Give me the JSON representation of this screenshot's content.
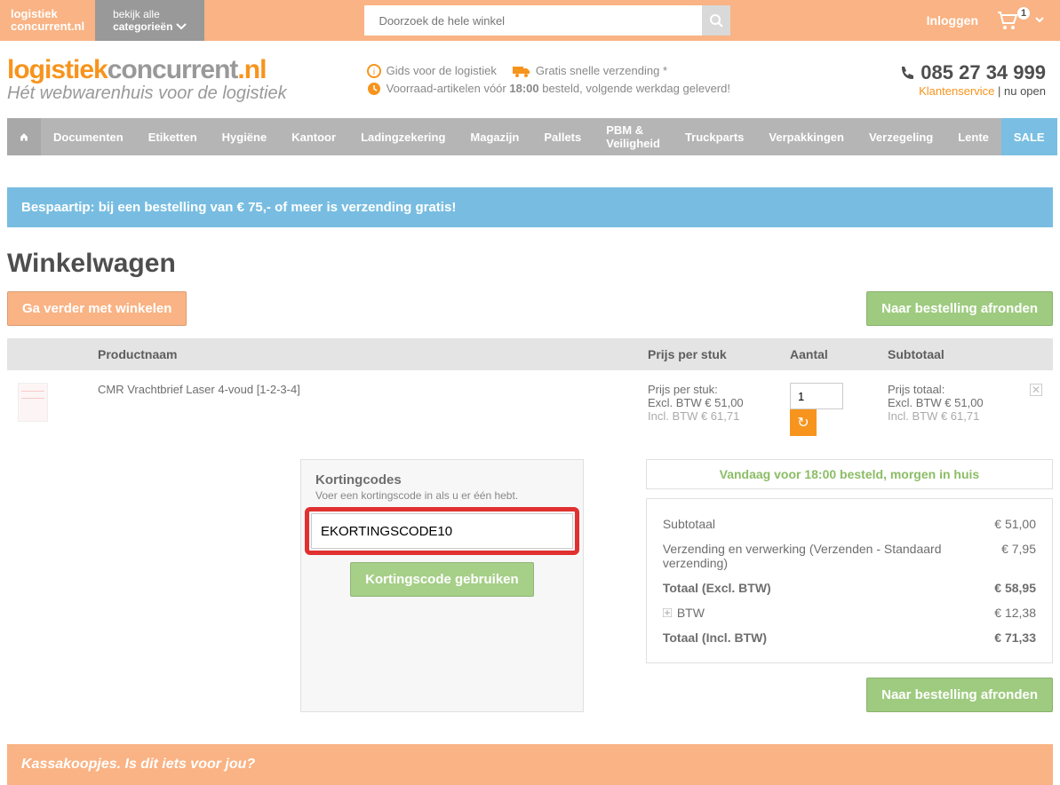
{
  "top": {
    "logo_line1": "logistiek",
    "logo_line2": "concurrent.nl",
    "cat_line1": "bekijk alle",
    "cat_line2": "categorieën",
    "search_placeholder": "Doorzoek de hele winkel",
    "login": "Inloggen",
    "cart_count": "1"
  },
  "header": {
    "logo_part1": "logistiek",
    "logo_part2": "concurrent",
    "logo_part3": ".nl",
    "tagline": "Hét webwarenhuis voor de logistiek",
    "usp_guide": "Gids voor de logistiek",
    "usp_shipping": "Gratis snelle verzending *",
    "usp_stock_pre": "Voorraad-artikelen vóór ",
    "usp_stock_bold": "18:00",
    "usp_stock_post": " besteld, volgende werkdag geleverd!",
    "phone": "085 27 34 999",
    "kservice": "Klantenservice",
    "kstatus": " | nu open"
  },
  "nav": {
    "items": [
      "Documenten",
      "Etiketten",
      "Hygiëne",
      "Kantoor",
      "Ladingzekering",
      "Magazijn",
      "Pallets",
      "PBM & Veiligheid",
      "Truckparts",
      "Verpakkingen",
      "Verzegeling",
      "Lente"
    ],
    "sale": "SALE"
  },
  "banner": "Bespaartip: bij een bestelling van € 75,- of meer is verzending gratis!",
  "page_title": "Winkelwagen",
  "btn_continue": "Ga verder met winkelen",
  "btn_checkout": "Naar bestelling afronden",
  "th": {
    "name": "Productnaam",
    "price": "Prijs per stuk",
    "qty": "Aantal",
    "sub": "Subtotaal"
  },
  "item": {
    "name": "CMR Vrachtbrief Laser 4-voud [1-2-3-4]",
    "price_label": "Prijs per stuk:",
    "price_excl": "Excl. BTW € 51,00",
    "price_incl": "Incl. BTW € 61,71",
    "qty": "1",
    "sub_label": "Prijs totaal:",
    "sub_excl": "Excl. BTW € 51,00",
    "sub_incl": "Incl. BTW € 61,71"
  },
  "coupon": {
    "title": "Kortingcodes",
    "hint": "Voer een kortingscode in als u er één hebt.",
    "value": "EKORTINGSCODE10",
    "apply": "Kortingscode gebruiken"
  },
  "ship_note": "Vandaag voor 18:00 besteld, morgen in huis",
  "totals": {
    "sub_l": "Subtotaal",
    "sub_v": "€ 51,00",
    "ship_l": "Verzending en verwerking (Verzenden - Standaard verzending)",
    "ship_v": "€ 7,95",
    "excl_l": "Totaal (Excl. BTW)",
    "excl_v": "€ 58,95",
    "btw_l": "BTW",
    "btw_v": "€ 12,38",
    "incl_l": "Totaal (Incl. BTW)",
    "incl_v": "€ 71,33"
  },
  "kassa": "Kassakoopjes. Is dit iets voor jou?"
}
